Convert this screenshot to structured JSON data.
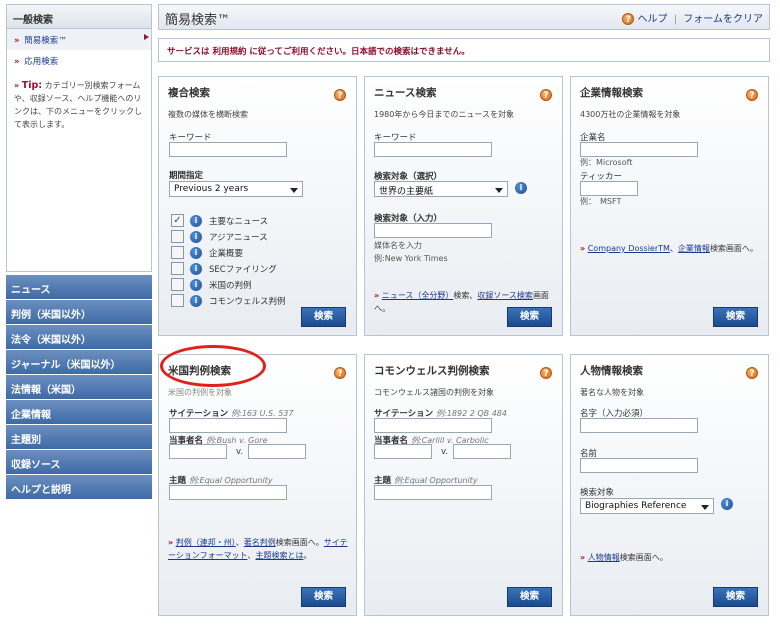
{
  "sidebar": {
    "title": "一般検索",
    "links": [
      {
        "label": "簡易検索™",
        "active": true
      },
      {
        "label": "応用検索",
        "active": false
      }
    ],
    "tip_label": "Tip:",
    "tip_text": "カテゴリー別検索フォームや、収録ソース、ヘルプ機能へのリンクは、下のメニューをクリックして表示します。"
  },
  "nav": {
    "items": [
      "ニュース",
      "判例（米国以外）",
      "法令（米国以外）",
      "ジャーナル（米国以外）",
      "法情報（米国）",
      "企業情報",
      "主題別",
      "収録ソース",
      "ヘルプと説明"
    ]
  },
  "header": {
    "title": "簡易検索™",
    "help_label": "ヘルプ",
    "clear_label": "フォームをクリア"
  },
  "notice": "サービスは 利用規約 に従ってご利用ください。日本語での検索はできません。",
  "cards": {
    "combined": {
      "title": "複合検索",
      "subtitle": "複数の媒体を横断検索",
      "keyword_label": "キーワード",
      "period_label": "期間指定",
      "period_value": "Previous 2 years",
      "checkboxes": [
        {
          "label": "主要なニュース",
          "checked": true
        },
        {
          "label": "アジアニュース",
          "checked": false
        },
        {
          "label": "企業概要",
          "checked": false
        },
        {
          "label": "SECファイリング",
          "checked": false
        },
        {
          "label": "米国の判例",
          "checked": false
        },
        {
          "label": "コモンウェルス判例",
          "checked": false
        }
      ],
      "button": "検索"
    },
    "news": {
      "title": "ニュース検索",
      "subtitle": "1980年から今日までのニュースを対象",
      "keyword_label": "キーワード",
      "target_select_label": "検索対象（選択）",
      "target_select_value": "世界の主要紙",
      "target_input_label": "検索対象（入力）",
      "media_name_label": "媒体名を入力",
      "media_example": "例:New York Times",
      "footer_link1": "ニュース（全分野）",
      "footer_text1": "検索、",
      "footer_link2": "収録ソース検索",
      "footer_text2": "画面へ。",
      "button": "検索"
    },
    "company": {
      "title": "企業情報検索",
      "subtitle": "4300万社の企業情報を対象",
      "name_label": "企業名",
      "name_example": "例：Microsoft",
      "ticker_label": "ティッカー",
      "ticker_example": "例：　MSFT",
      "footer_link1": "Company DossierTM",
      "footer_text1": "、",
      "footer_link2": "企業情報",
      "footer_text2": "検索画面へ。",
      "button": "検索"
    },
    "us_case": {
      "title": "米国判例検索",
      "subtitle": "米国の判例を対象",
      "citation_label": "サイテーション",
      "citation_example": "例:163 U.S. 537",
      "parties_label": "当事者名",
      "parties_example": "例:Bush v. Gore",
      "versus": "v.",
      "topic_label": "主題",
      "topic_example": "例:Equal Opportunity",
      "footer_link1": "判例（連邦・州）",
      "footer_text1": "、",
      "footer_link2": "著名判例",
      "footer_text2": "検索画面へ。",
      "footer_link3": "サイテーションフォーマット",
      "footer_text3": "、",
      "footer_link4": "主題検索とは",
      "footer_text4": "。",
      "button": "検索"
    },
    "commonwealth": {
      "title": "コモンウェルス判例検索",
      "subtitle": "コモンウェルス諸国の判例を対象",
      "citation_label": "サイテーション",
      "citation_example": "例:1892 2 QB 484",
      "parties_label": "当事者名",
      "parties_example": "例:Carlill v. Carbolic",
      "versus": "v.",
      "topic_label": "主題",
      "topic_example": "例:Equal Opportunity",
      "button": "検索"
    },
    "person": {
      "title": "人物情報検索",
      "subtitle": "著名な人物を対象",
      "surname_label": "名字（入力必須）",
      "given_label": "名前",
      "target_label": "検索対象",
      "target_value": "Biographies Reference",
      "footer_link1": "人物情報",
      "footer_text1": "検索画面へ。",
      "button": "検索"
    }
  },
  "annotation_color": "#e0201b"
}
